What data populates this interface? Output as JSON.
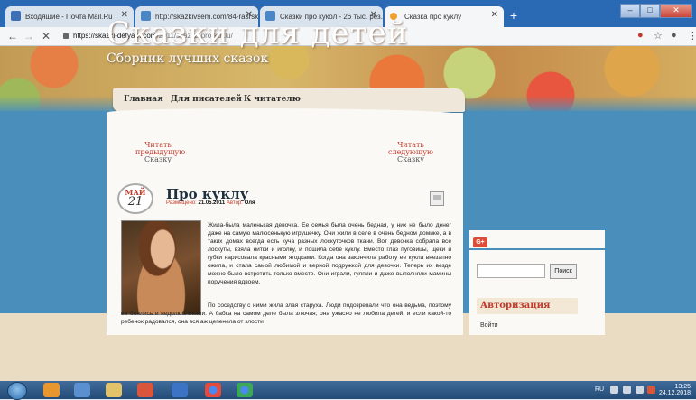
{
  "browser": {
    "tabs": [
      {
        "label": "Входящие - Почта Mail.Ru",
        "favicon_color": "#3d6fb6"
      },
      {
        "label": "http://skazkivsem.com/84-rasrsk",
        "favicon_color": "#4a86c6"
      },
      {
        "label": "Сказки про кукол - 26 тыс. рез...",
        "favicon_color": "#4a86c6"
      },
      {
        "label": "Сказка про куклу",
        "favicon_color": "#f0a030"
      }
    ],
    "new_tab": "+",
    "window_buttons": {
      "min": "–",
      "max": "□",
      "close": "✕"
    },
    "url": {
      "host": "https://skazki-detyam.com",
      "path": "/2011/skazka-pro-kuklu/"
    }
  },
  "site": {
    "title": "Сказки для детей",
    "subtitle": "Сборник лучших сказок",
    "menu": [
      "Главная",
      "Для писателей",
      "К читателю"
    ]
  },
  "post_nav": {
    "prev": {
      "line1": "Читать",
      "line2": "предыдущую",
      "line3": "Сказку"
    },
    "next": {
      "line1": "Читать",
      "line2": "следующую",
      "line3": "Сказку"
    }
  },
  "post": {
    "date_month": "МАЙ",
    "date_day": "21",
    "title": "Про куклу",
    "meta_posted_label": "Размещено:",
    "meta_date": "21.05.2011",
    "meta_author_label": "Автор:",
    "meta_author": "Оля",
    "paragraph1": "Жила-была маленькая девочка. Ее семья была очень бедная, у них не было денег даже на самую малюсенькую игрушечку. Они жили в селе в очень бедном домике, а в таких домах всегда есть куча разных лоскуточков ткани. Вот девочка собрала все лоскуты, взяла нитки и иголку, и пошила себе куклу. Вместо глаз пуговицы, щеки и губки нарисовала красными ягодками. Когда она закончила работу ее кукла внезапно ожила, и стала самой любимой и верной подружкой для девочки. Теперь их везде можно было встретить только вместе. Они играли, гуляли и даже выполняли мамины поручения вдвоем.",
    "paragraph2": "По соседству с ними жила злая старуха. Люди подозревали что она ведьма, поэтому ее боялись и недолюбливали. А бабка на самом деле была злючая, она ужасно не любила детей, и если какой-то ребенок радовался, она вся аж цепенела от злости."
  },
  "sidebar": {
    "gplus": "G+",
    "search_button": "Поиск",
    "widget_title": "Авторизация",
    "login_link": "Войти"
  },
  "taskbar": {
    "lang": "RU",
    "time": "13:25",
    "date": "24.12.2018"
  }
}
